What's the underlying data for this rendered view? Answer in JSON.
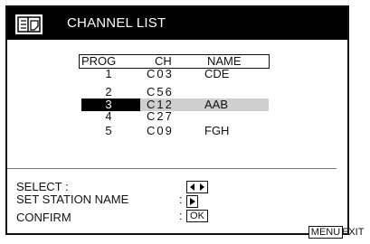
{
  "menu": {
    "title": "CHANNEL LIST",
    "icon": "channel-list-icon"
  },
  "table": {
    "headers": {
      "prog": "PROG",
      "ch": "CH",
      "name": "NAME"
    },
    "rows": [
      {
        "prog": "1",
        "ch": "C03",
        "name": "CDE",
        "selected": false
      },
      {
        "prog": "2",
        "ch": "C56",
        "name": "",
        "selected": false
      },
      {
        "prog": "3",
        "ch": "C12",
        "name": "AAB",
        "selected": true
      },
      {
        "prog": "4",
        "ch": "C27",
        "name": "",
        "selected": false
      },
      {
        "prog": "5",
        "ch": "C09",
        "name": "FGH",
        "selected": false
      }
    ]
  },
  "help": {
    "select_label": "SELECT :",
    "set_station_label": "SET STATION NAME",
    "confirm_label": "CONFIRM",
    "colon": ":",
    "select_icon": "left-right-arrows-icon",
    "set_station_icon": "right-arrow-icon",
    "ok_key": "OK"
  },
  "footer": {
    "menu_key": "MENU",
    "exit_label": "EXIT"
  }
}
